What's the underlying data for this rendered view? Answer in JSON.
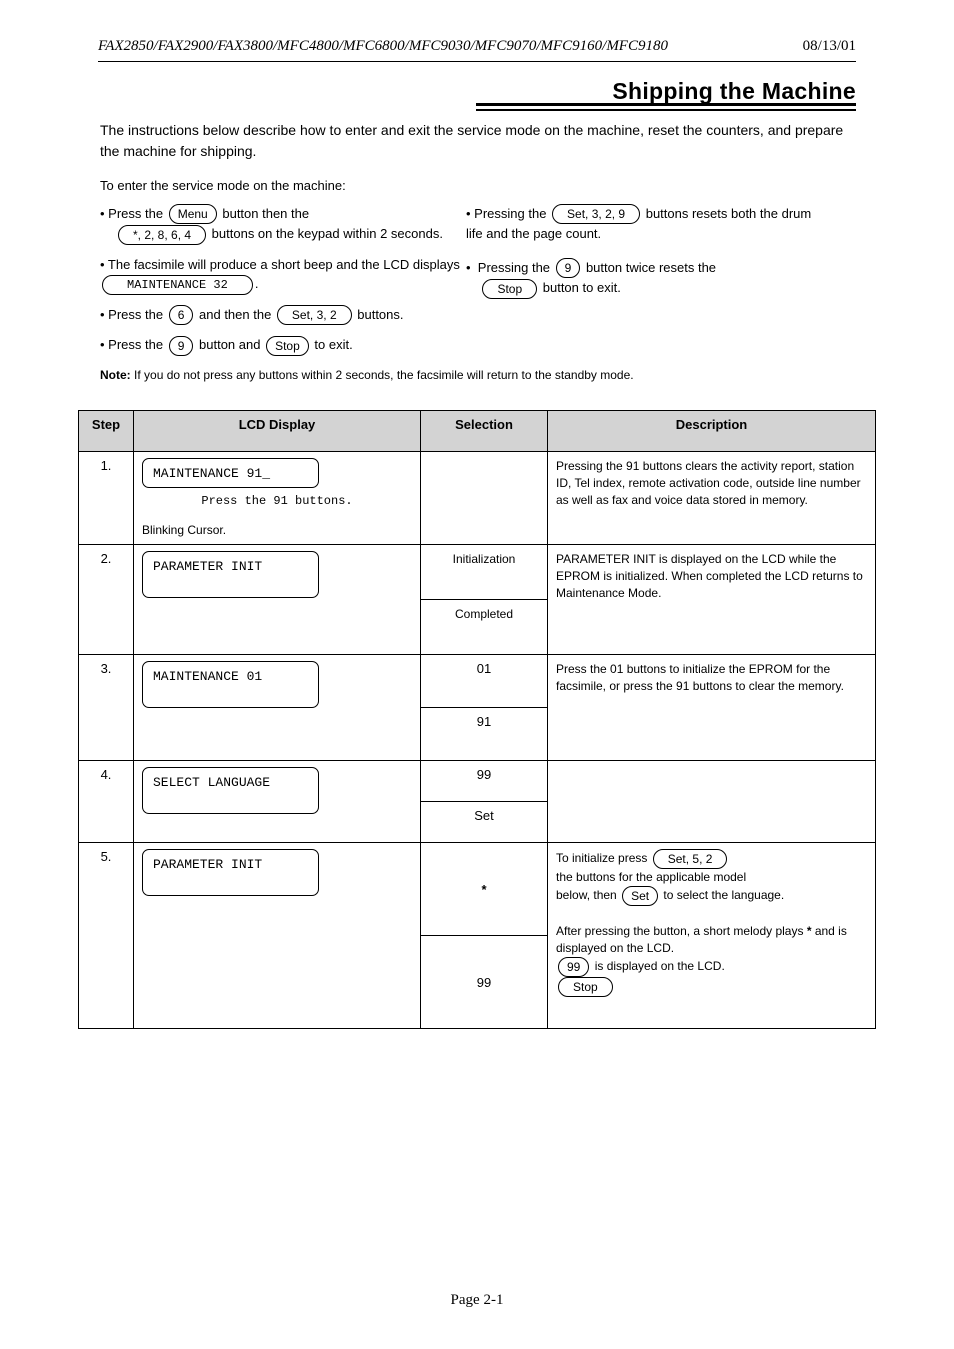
{
  "header": {
    "left": "FAX2850/FAX2900/FAX3800/MFC4800/MFC6800/MFC9030/MFC9070/MFC9160/MFC9180",
    "right": "08/13/01"
  },
  "section_title": "Shipping the Machine",
  "intro": {
    "lead": "The instructions below describe how to enter and exit the service mode on the machine, reset the counters, and prepare the machine for shipping.",
    "sub_intro": "To enter the service mode on the machine:",
    "left_bullets": [
      {
        "prefix": "•  Press the ",
        "key": "Menu",
        "mid": " button then the",
        "key2": "*, 2, 8, 6, 4",
        "suffix": " buttons on the keypad within 2 seconds."
      },
      {
        "plain": "•  The facsimile will produce a short beep and the LCD displays "
      },
      {
        "prefix": "•  Press the ",
        "key": "6",
        "mid": " and then the ",
        "key2": "Set, 3, 2",
        "suffix": " buttons."
      },
      {
        "prefix": "•  Press the ",
        "key": "9",
        "mid": " button and ",
        "key2": "Stop",
        "suffix": " to exit."
      }
    ],
    "right_bullets": [
      {
        "prefix": "•  Pressing the ",
        "key": "Set, 3, 2, 9",
        "suffix": " buttons resets both the drum life and the page count."
      },
      {
        "plain_html": "•  Pressing the <span class=\"key\">9</span> button twice resets the <span class=\"key key-wide\">Stop</span> button to exit."
      }
    ],
    "monospace_line": "MAINTENANCE 32",
    "note_label": "Note:",
    "note_text": " If you do not press any buttons within 2 seconds, the facsimile will return to the standby mode."
  },
  "table": {
    "headers": [
      "Step",
      "LCD Display",
      "Selection",
      "Description"
    ],
    "rows": [
      {
        "step": "1.",
        "lcd_lines": [
          "MAINTENANCE 91_",
          "Press the 91 buttons."
        ],
        "lcd_cursor_note": "Blinking Cursor.",
        "selection_rows": [
          {
            "code": "",
            "text": ""
          }
        ],
        "desc": "Pressing the 91 buttons clears the activity report, station ID, Tel index, remote activation code, outside line number as well as fax and voice data stored in memory."
      },
      {
        "step": "2.",
        "lcd_lines": [
          "PARAMETER INIT",
          ""
        ],
        "lcd_cursor_note": "",
        "selection_rows": [
          {
            "code": "",
            "text": "Initialization"
          },
          {
            "code": "",
            "text": "Completed"
          }
        ],
        "desc": "PARAMETER INIT is displayed on the LCD while the EPROM is initialized. When completed the LCD returns to Maintenance Mode."
      },
      {
        "step": "3.",
        "lcd_lines": [
          "MAINTENANCE 01",
          ""
        ],
        "lcd_cursor_note": "",
        "selection_rows": [
          {
            "code": "01",
            "text": ""
          },
          {
            "code": "91",
            "text": ""
          }
        ],
        "desc": "Press the 01 buttons to initialize the EPROM for the facsimile, or press the 91 buttons to clear the memory."
      },
      {
        "step": "4.",
        "lcd_lines": [
          "SELECT LANGUAGE",
          ""
        ],
        "lcd_cursor_note": "",
        "selection_rows": [
          {
            "code": "99",
            "text": ""
          },
          {
            "code": "Set",
            "text": ""
          }
        ],
        "desc": ""
      },
      {
        "step": "5.",
        "lcd_lines": [
          "PARAMETER INIT",
          ""
        ],
        "lcd_cursor_note": "",
        "selection_star": "*",
        "selection_rows": [
          {
            "code": "",
            "text": ""
          },
          {
            "code": "99",
            "text": ""
          }
        ],
        "desc_lines": [
          "To initialize press ",
          "the buttons for the applicable model",
          "below, then ",
          " to select the language.",
          "",
          "After pressing the  button, a short melody plays",
          "and  is displayed on the LCD.",
          " is displayed on the LCD."
        ],
        "desc_keys": [
          "Set, 5, 2",
          "Set",
          "*",
          "99",
          "Stop"
        ]
      }
    ]
  },
  "footer": "Page 2-1"
}
